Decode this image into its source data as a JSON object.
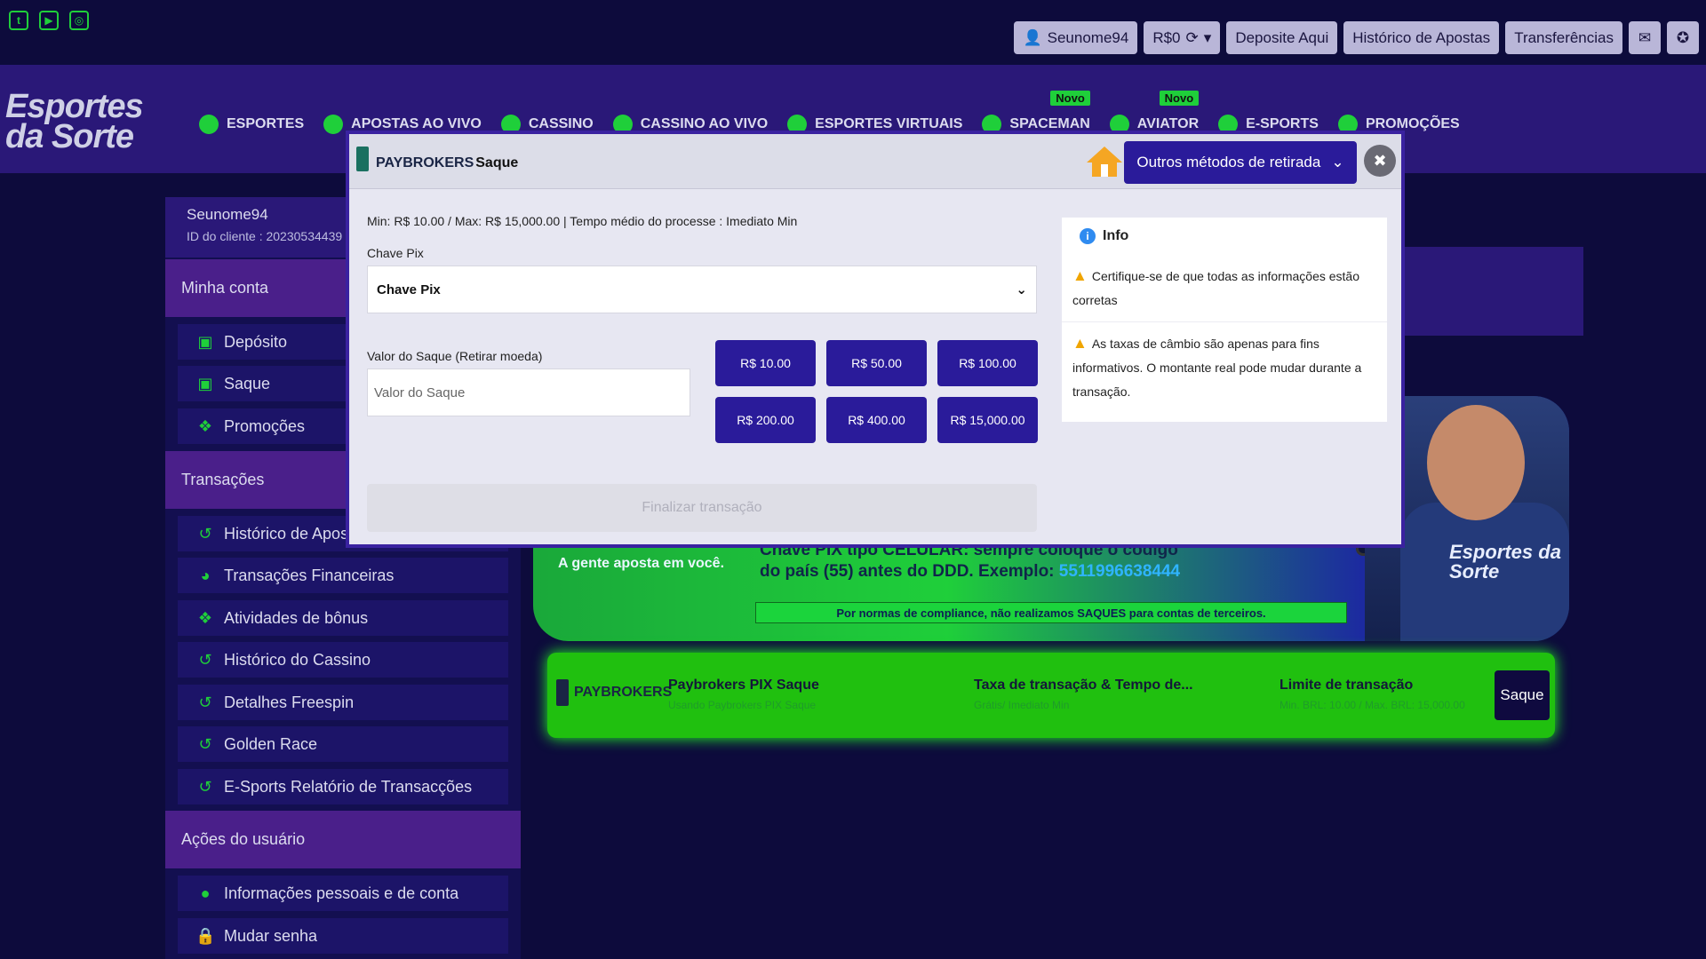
{
  "social": [
    "twitter-icon",
    "youtube-icon",
    "instagram-icon"
  ],
  "user_actions": {
    "username": "Seunome94",
    "balance": "R$0",
    "deposit": "Deposite Aqui",
    "history": "Histórico de Apostas",
    "transfers": "Transferências"
  },
  "logo": {
    "line1": "Esportes",
    "line2": "da Sorte"
  },
  "nav": {
    "items": [
      {
        "label": "ESPORTES",
        "badge": ""
      },
      {
        "label": "APOSTAS AO VIVO",
        "badge": ""
      },
      {
        "label": "CASSINO",
        "badge": ""
      },
      {
        "label": "CASSINO AO VIVO",
        "badge": ""
      },
      {
        "label": "ESPORTES VIRTUAIS",
        "badge": ""
      },
      {
        "label": "SPACEMAN",
        "badge": "Novo"
      },
      {
        "label": "AVIATOR",
        "badge": "Novo"
      },
      {
        "label": "E-SPORTS",
        "badge": ""
      },
      {
        "label": "PROMOÇÕES",
        "badge": ""
      }
    ]
  },
  "profile": {
    "name": "Seunome94",
    "client_id": "ID do cliente : 20230534439"
  },
  "sidebar": {
    "account_title": "Minha conta",
    "account_items": [
      "Depósito",
      "Saque",
      "Promoções"
    ],
    "transactions_title": "Transações",
    "transaction_items": [
      "Histórico de Apostas",
      "Transações Financeiras",
      "Atividades de bônus",
      "Histórico do Cassino",
      "Detalhes Freespin",
      "Golden Race",
      "E-Sports Relatório de Transacções"
    ],
    "user_actions_title": "Ações do usuário",
    "user_action_items": [
      "Informações pessoais e de conta",
      "Mudar senha"
    ]
  },
  "banner": {
    "tagline": "A gente aposta em você.",
    "line1": "Chave PIX tipo CELULAR: sempre coloque o código",
    "line2": "do país (55) antes do DDD. Exemplo:",
    "example": "5511996638444",
    "footer": "Por normas de compliance, não realizamos SAQUES para contas de terceiros.",
    "brand": "Esportes da Sorte"
  },
  "pay_card": {
    "logo": "PAYBROKERS",
    "method_title": "Paybrokers PIX Saque",
    "method_sub": "Usando Paybrokers PIX Saque",
    "fee_title": "Taxa de transação & Tempo de...",
    "fee_sub": "Grátis/ Imediato Min",
    "limit_title": "Limite de transação",
    "limit_sub": "Min. BRL: 10.00 / Max. BRL: 15,000.00",
    "button": "Saque"
  },
  "modal": {
    "logo": "PAYBROKERS",
    "title": "Saque",
    "other_methods": "Outros métodos de retirada",
    "limits": "Min: R$ 10.00 / Max: R$ 15,000.00 | Tempo médio do processe : Imediato Min",
    "pix_label": "Chave Pix",
    "pix_selected": "Chave Pix",
    "amount_label": "Valor do Saque (Retirar moeda)",
    "amount_placeholder": "Valor do Saque",
    "quick_amounts": [
      "R$ 10.00",
      "R$ 50.00",
      "R$ 100.00",
      "R$ 200.00",
      "R$ 400.00",
      "R$ 15,000.00"
    ],
    "finalize": "Finalizar transação",
    "info_title": "Info",
    "info_messages": [
      "Certifique-se de que todas as informações estão corretas",
      "As taxas de câmbio são apenas para fins informativos. O montante real pode mudar durante a transação."
    ]
  },
  "colors": {
    "accent_green": "#1fcf3a",
    "primary_purple": "#2a1b9a",
    "background": "#0d0b3c"
  }
}
